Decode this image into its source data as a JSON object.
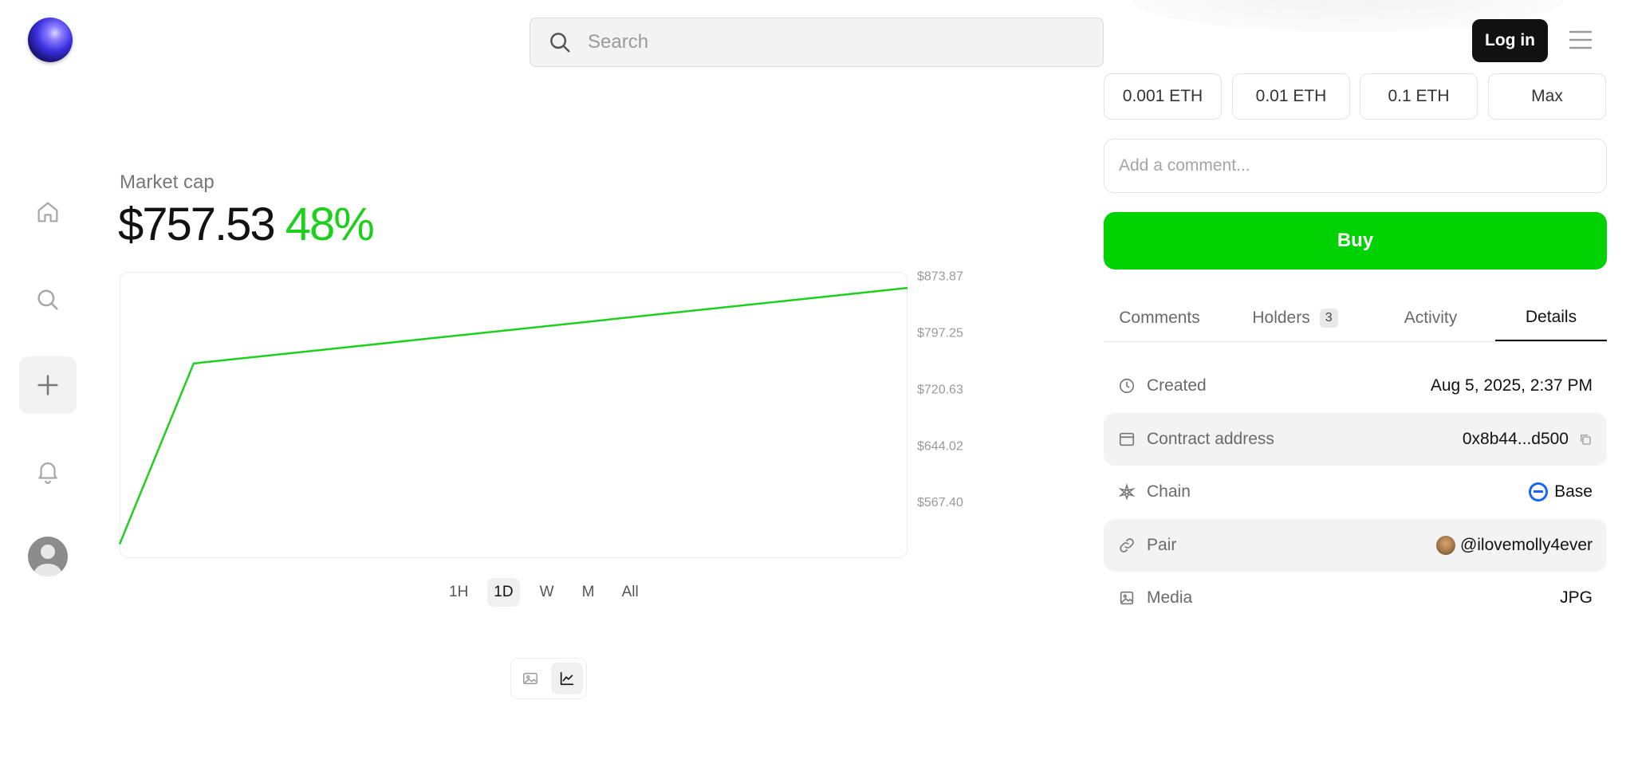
{
  "header": {
    "search": {
      "placeholder": "Search"
    },
    "login_label": "Log in"
  },
  "icons": {
    "nav": [
      "home-icon",
      "search-icon",
      "plus-icon",
      "bell-icon"
    ],
    "menu": "hamburger-menu-icon"
  },
  "market": {
    "label": "Market cap",
    "value": "$757.53",
    "change": "48%",
    "change_color": "#1ed01e"
  },
  "chart_data": {
    "type": "line",
    "title": "",
    "xlabel": "",
    "ylabel": "",
    "y_ticks": [
      "$873.87",
      "$797.25",
      "$720.63",
      "$644.02",
      "$567.40"
    ],
    "series": [
      {
        "color": "#1ed01e",
        "x": [
          0,
          0.094,
          1
        ],
        "y": [
          511.0,
          755.9,
          858.2
        ]
      }
    ],
    "ylim": [
      492.0,
      880.0
    ],
    "grid": false
  },
  "timeframes": {
    "options": [
      "1H",
      "1D",
      "W",
      "M",
      "All"
    ],
    "selected": "1D"
  },
  "view_toggle": {
    "options": [
      "image-icon",
      "chart-icon"
    ],
    "selected": "chart-icon"
  },
  "trade": {
    "amounts": [
      "0.001 ETH",
      "0.01 ETH",
      "0.1 ETH",
      "Max"
    ],
    "comment_placeholder": "Add a comment...",
    "buy_label": "Buy"
  },
  "tabs": [
    {
      "label": "Comments",
      "badge": ""
    },
    {
      "label": "Holders",
      "badge": "3"
    },
    {
      "label": "Activity",
      "badge": ""
    },
    {
      "label": "Details",
      "badge": ""
    }
  ],
  "active_tab": "Details",
  "details": [
    {
      "label": "Created",
      "value": "Aug 5, 2025, 2:37 PM",
      "icon": "clock-icon"
    },
    {
      "label": "Contract address",
      "value": "0x8b44...d500",
      "icon": "contract-icon"
    },
    {
      "label": "Chain",
      "value": "Base",
      "icon": "chain-icon"
    },
    {
      "label": "Pair",
      "value": "@ilovemolly4ever",
      "icon": "link-icon"
    },
    {
      "label": "Media",
      "value": "JPG",
      "icon": "media-icon"
    }
  ]
}
